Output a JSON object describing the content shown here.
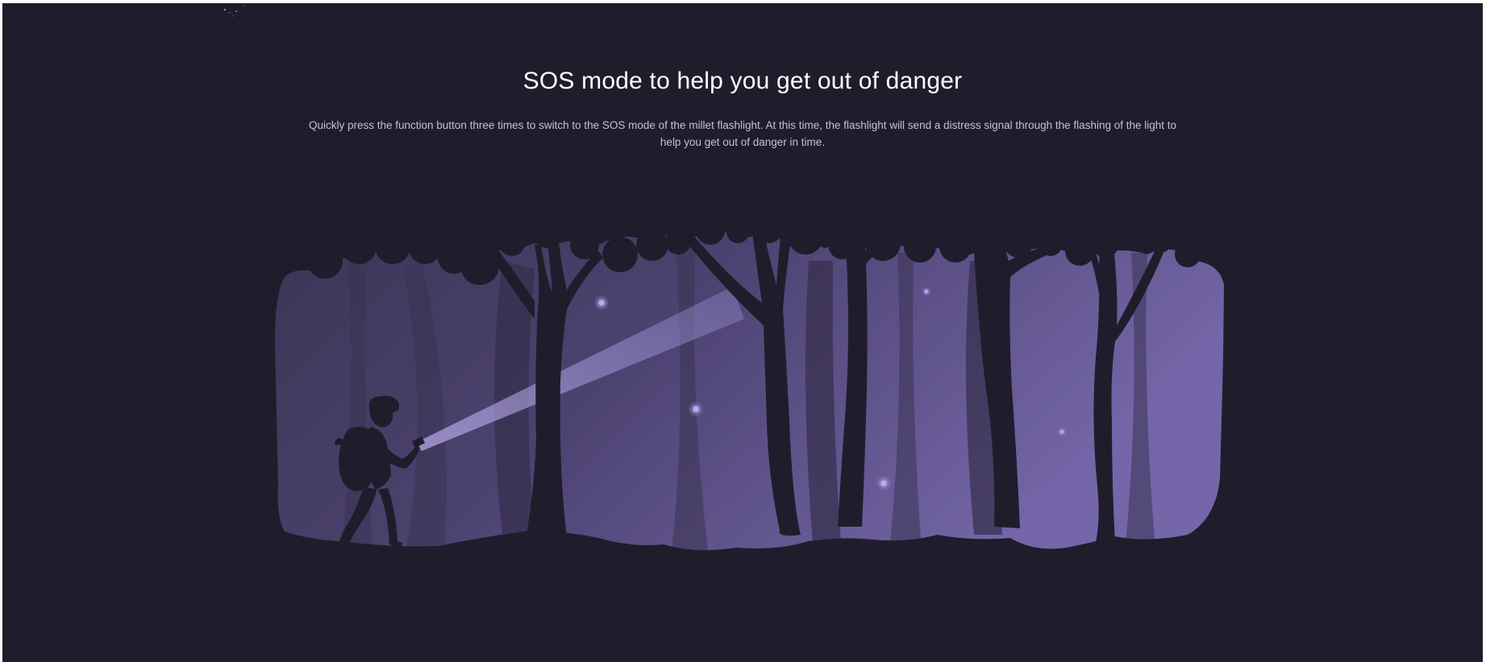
{
  "section": {
    "title": "SOS mode to help you get out of danger",
    "description": "Quickly press the function button three times to switch to the SOS mode of the millet flashlight. At this time, the flashlight will send a distress signal through the flashing of the light to help you get out of danger in time."
  },
  "illustration": {
    "subject": "hiker-with-flashlight-in-forest",
    "icon": "forest-illustration"
  },
  "colors": {
    "background": "#1f1d2b",
    "forest_light": "#6e5fa0",
    "forest_dark": "#2f2a44",
    "silhouette": "#1f1d2b",
    "title": "#ffffff",
    "body_text": "#c4c2d0"
  }
}
